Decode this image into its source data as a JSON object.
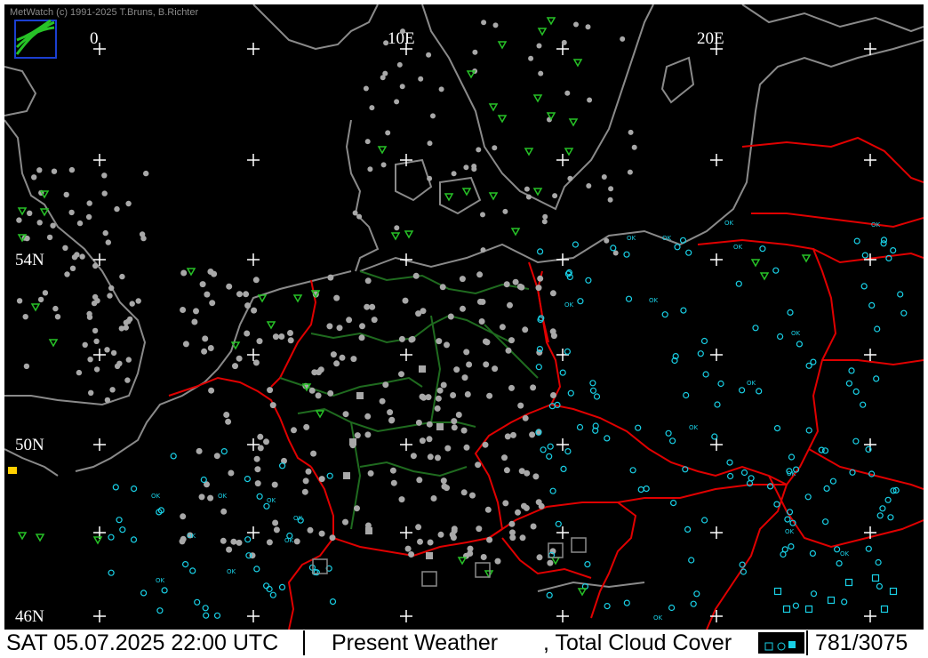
{
  "header": {
    "credit": "MetWatch  (c) 1991-2025 T.Bruns, B.Richter"
  },
  "map": {
    "grid_labels": {
      "lon_0": "0",
      "lon_10e": "10E",
      "lon_20e": "20E",
      "lat_54n": "54N",
      "lat_50n": "50N",
      "lat_46n": "46N"
    },
    "colors": {
      "background": "#000000",
      "coastline": "#8a8a8a",
      "country_border": "#e00000",
      "state_border": "#1f6b1f",
      "graticule": "#ffffff",
      "cloud_symbol": "#19d0e6",
      "weather_symbol": "#27c227",
      "station_grey": "#a8a8a8"
    },
    "symbol_ok": "OK"
  },
  "status": {
    "datetime": "SAT 05.07.2025 22:00 UTC",
    "parameter": "Present Weather",
    "secondary_parameter": ", Total Cloud Cover",
    "station_count": "781/3075"
  }
}
